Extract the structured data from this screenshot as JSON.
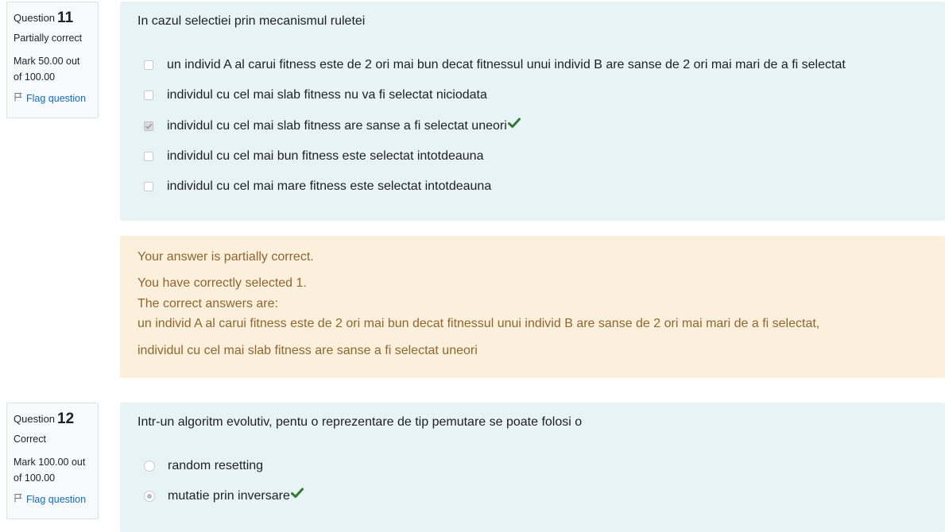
{
  "q11": {
    "info": {
      "question_label": "Question",
      "number": "11",
      "state": "Partially correct",
      "mark_line1": "Mark 50.00 out",
      "mark_line2": "of 100.00",
      "flag_label": "Flag question"
    },
    "question_text": "In cazul selectiei prin mecanismul ruletei",
    "options": [
      {
        "label": "un individ A al carui fitness este de 2 ori mai bun decat fitnessul unui individ B are sanse de 2 ori mai mari de a fi selectat",
        "checked": false,
        "correct_mark": false
      },
      {
        "label": "individul cu cel mai slab fitness nu va fi selectat niciodata",
        "checked": false,
        "correct_mark": false
      },
      {
        "label": "individul cu cel mai slab fitness are sanse a fi selectat uneori",
        "checked": true,
        "correct_mark": true
      },
      {
        "label": "individul cu cel mai bun fitness este selectat intotdeauna",
        "checked": false,
        "correct_mark": false
      },
      {
        "label": "individul cu cel mai mare fitness este selectat intotdeauna",
        "checked": false,
        "correct_mark": false
      }
    ],
    "feedback": {
      "summary": "Your answer is partially correct.",
      "selected": "You have correctly selected 1.",
      "correct_intro": "The correct answers are:",
      "answer1": "un individ A al carui fitness este de 2 ori mai bun decat fitnessul unui individ B are sanse de 2 ori mai mari de a fi selectat,",
      "answer2": "individul cu cel mai slab fitness are sanse a fi selectat uneori"
    }
  },
  "q12": {
    "info": {
      "question_label": "Question",
      "number": "12",
      "state": "Correct",
      "mark_line1": "Mark 100.00 out",
      "mark_line2": "of 100.00",
      "flag_label": "Flag question"
    },
    "question_text": "Intr-un algoritm evolutiv, pentu o reprezentare de tip pemutare se poate folosi o",
    "options": [
      {
        "label": "random resetting",
        "checked": false,
        "correct_mark": false
      },
      {
        "label": "mutatie prin inversare",
        "checked": true,
        "correct_mark": true
      }
    ]
  },
  "colors": {
    "formulation_bg": "#e7f3f5",
    "feedback_bg": "#fcefdc",
    "feedback_text": "#8e662e",
    "correct_tick": "#357a32",
    "link": "#0f6cbf"
  },
  "icons": {
    "flag": "flag-icon",
    "tick": "check-icon"
  }
}
